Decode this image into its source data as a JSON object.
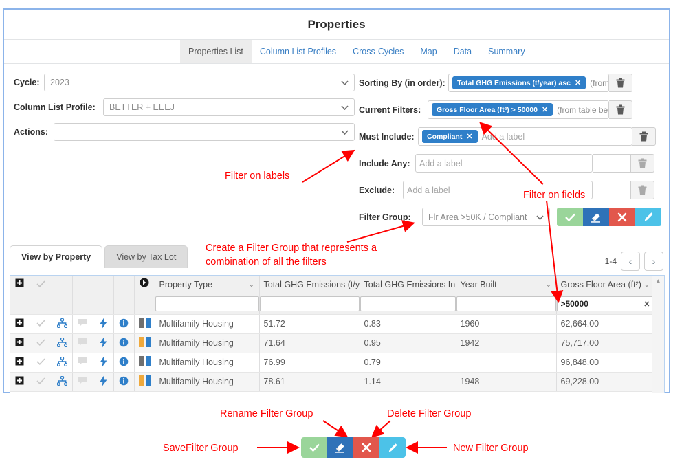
{
  "window": {
    "title": "Properties"
  },
  "tabs": [
    {
      "label": "Properties List",
      "active": true
    },
    {
      "label": "Column List Profiles",
      "active": false
    },
    {
      "label": "Cross-Cycles",
      "active": false
    },
    {
      "label": "Map",
      "active": false
    },
    {
      "label": "Data",
      "active": false
    },
    {
      "label": "Summary",
      "active": false
    }
  ],
  "left_form": {
    "cycle": {
      "label": "Cycle:",
      "value": "2023"
    },
    "column_list_profile": {
      "label": "Column List Profile:",
      "value": "BETTER + EEEJ"
    },
    "actions": {
      "label": "Actions:",
      "value": ""
    }
  },
  "right_form": {
    "sorting_by": {
      "label": "Sorting By (in order):",
      "badges": [
        "Total GHG Emissions (t/year) asc"
      ],
      "hint": "(from table below)"
    },
    "current_filters": {
      "label": "Current Filters:",
      "badges": [
        "Gross Floor Area (ft²) > 50000"
      ],
      "hint": "(from table below)"
    },
    "must_include": {
      "label": "Must Include:",
      "badges": [
        "Compliant"
      ],
      "placeholder": "Add a label"
    },
    "include_any": {
      "label": "Include Any:",
      "placeholder": "Add a label"
    },
    "exclude": {
      "label": "Exclude:",
      "placeholder": "Add a label"
    },
    "filter_group": {
      "label": "Filter Group:",
      "value": "Flr Area >50K / Compliant",
      "buttons": [
        {
          "name": "save",
          "icon": "check-icon",
          "color": "#9ad59a"
        },
        {
          "name": "rename",
          "icon": "eraser-icon",
          "color": "#2f72b8"
        },
        {
          "name": "delete",
          "icon": "close-x-icon",
          "color": "#e2574c"
        },
        {
          "name": "new",
          "icon": "pencil-icon",
          "color": "#4cc2e8"
        }
      ]
    },
    "delete_button_title": "Delete"
  },
  "view_tabs": [
    {
      "label": "View by Property",
      "active": true
    },
    {
      "label": "View by Tax Lot",
      "active": false
    }
  ],
  "pagination": {
    "range": "1-4",
    "prev": "‹",
    "next": "›"
  },
  "table": {
    "columns": [
      {
        "label": "Property Type",
        "filter_value": "",
        "sortable": true
      },
      {
        "label": "Total GHG Emissions (t/y..",
        "filter_value": "",
        "sortable": false
      },
      {
        "label": "Total GHG Emissions Int..",
        "filter_value": "",
        "sortable": false
      },
      {
        "label": "Year Built",
        "filter_value": "",
        "sortable": true
      },
      {
        "label": "Gross Floor Area (ft²)",
        "filter_value": ">50000",
        "sortable": true
      }
    ],
    "rows": [
      {
        "property_type": "Multifamily Housing",
        "total_ghg": "51.72",
        "ghg_intensity": "0.83",
        "year_built": "1960",
        "gross_floor_area": "62,664.00",
        "bar1": "#6f6f6f",
        "bar2": "#2f7fc9"
      },
      {
        "property_type": "Multifamily Housing",
        "total_ghg": "71.64",
        "ghg_intensity": "0.95",
        "year_built": "1942",
        "gross_floor_area": "75,717.00",
        "bar1": "#efa93c",
        "bar2": "#2f7fc9"
      },
      {
        "property_type": "Multifamily Housing",
        "total_ghg": "76.99",
        "ghg_intensity": "0.79",
        "year_built": "",
        "gross_floor_area": "96,848.00",
        "bar1": "#6f6f6f",
        "bar2": "#2f7fc9"
      },
      {
        "property_type": "Multifamily Housing",
        "total_ghg": "78.61",
        "ghg_intensity": "1.14",
        "year_built": "1948",
        "gross_floor_area": "69,228.00",
        "bar1": "#efa93c",
        "bar2": "#2f7fc9"
      }
    ]
  },
  "annotations": {
    "filter_on_labels": "Filter on labels",
    "filter_on_fields": "Filter on fields",
    "create_filter_group_line1": "Create a Filter Group that represents a",
    "create_filter_group_line2": "combination of all the filters",
    "rename_filter_group": "Rename Filter Group",
    "delete_filter_group": "Delete Filter Group",
    "save_filter_group": "SaveFilter Group",
    "new_filter_group": "New Filter Group",
    "color": "#ff0000"
  }
}
